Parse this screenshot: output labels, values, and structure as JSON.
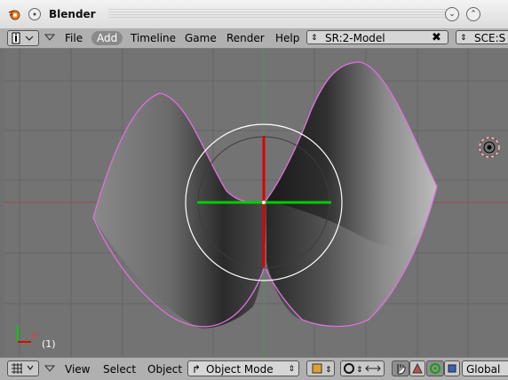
{
  "window": {
    "title": "Blender",
    "icons": [
      "blender-logo-icon",
      "circle-menu-icon",
      "collapse-icon",
      "maximize-icon"
    ]
  },
  "header": {
    "menus": [
      "File",
      "Add",
      "Timeline",
      "Game",
      "Render",
      "Help"
    ],
    "screen_field": "SR:2-Model",
    "scene_field": "SCE:S"
  },
  "viewport": {
    "frame_label": "(1)",
    "axis_x": "x"
  },
  "footer": {
    "menus": [
      "View",
      "Select",
      "Object"
    ],
    "mode": "Object Mode",
    "orientation": "Global"
  },
  "colors": {
    "outline": "#e070e0",
    "manip_x": "#dd0000",
    "manip_y": "#00cc00",
    "grid_x_axis": "#a04848",
    "grid_y_axis": "#4a9a4a"
  }
}
